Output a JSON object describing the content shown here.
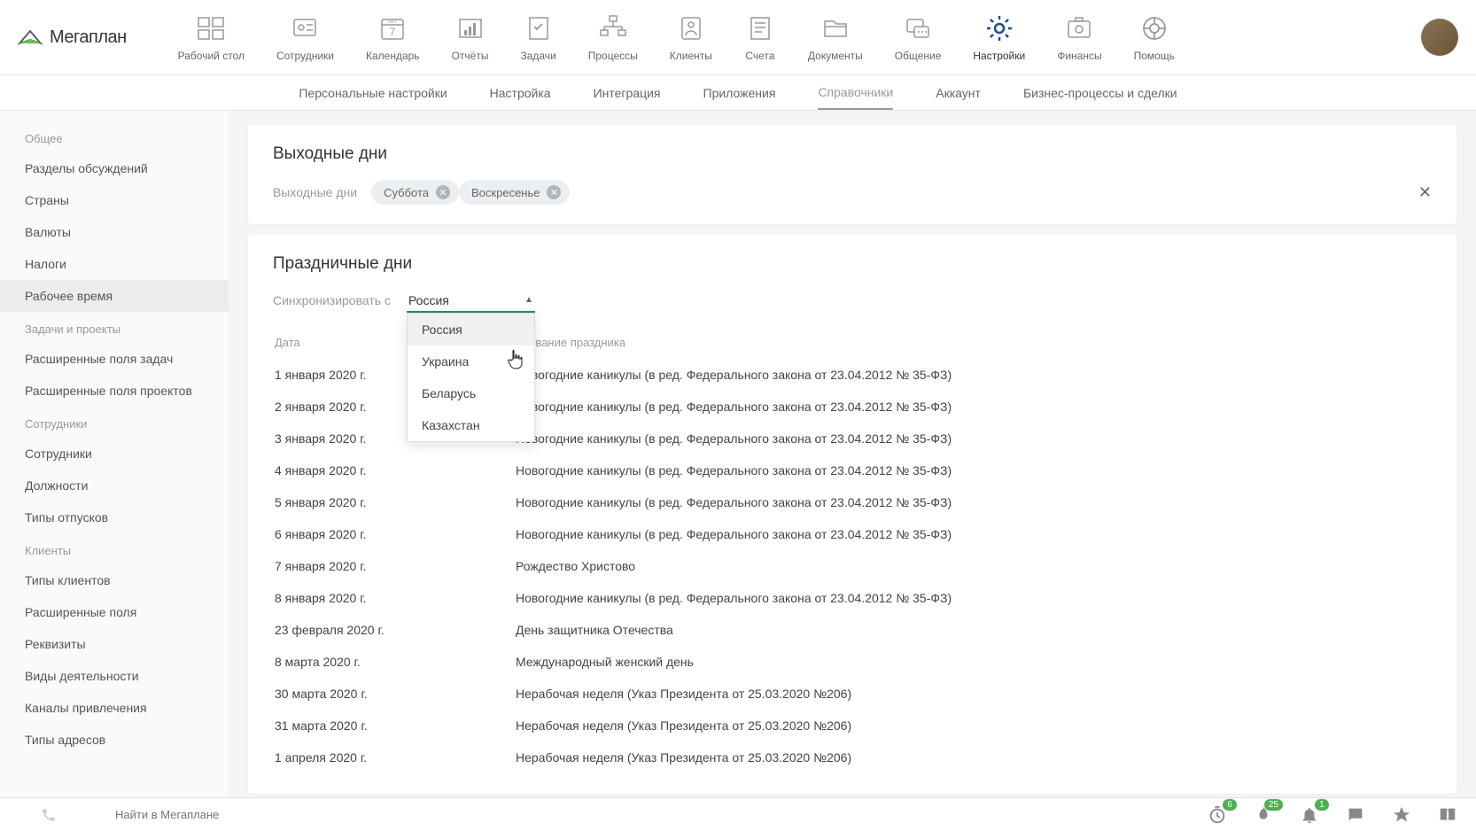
{
  "logo_text": "Мегаплан",
  "main_nav": [
    {
      "label": "Рабочий стол"
    },
    {
      "label": "Сотрудники"
    },
    {
      "label": "Календарь",
      "day": "7",
      "month": "ОКТ"
    },
    {
      "label": "Отчёты"
    },
    {
      "label": "Задачи"
    },
    {
      "label": "Процессы"
    },
    {
      "label": "Клиенты"
    },
    {
      "label": "Счета"
    },
    {
      "label": "Документы"
    },
    {
      "label": "Общение"
    },
    {
      "label": "Настройки"
    },
    {
      "label": "Финансы"
    },
    {
      "label": "Помощь"
    }
  ],
  "subnav": [
    {
      "label": "Персональные настройки"
    },
    {
      "label": "Настройка"
    },
    {
      "label": "Интеграция"
    },
    {
      "label": "Приложения"
    },
    {
      "label": "Справочники"
    },
    {
      "label": "Аккаунт"
    },
    {
      "label": "Бизнес-процессы и сделки"
    }
  ],
  "sidebar": [
    {
      "header": "Общее",
      "items": [
        "Разделы обсуждений",
        "Страны",
        "Валюты",
        "Налоги",
        "Рабочее время"
      ]
    },
    {
      "header": "Задачи и проекты",
      "items": [
        "Расширенные поля задач",
        "Расширенные поля проектов"
      ]
    },
    {
      "header": "Сотрудники",
      "items": [
        "Сотрудники",
        "Должности",
        "Типы отпусков"
      ]
    },
    {
      "header": "Клиенты",
      "items": [
        "Типы клиентов",
        "Расширенные поля",
        "Реквизиты",
        "Виды деятельности",
        "Каналы привлечения",
        "Типы адресов"
      ]
    }
  ],
  "weekends": {
    "title": "Выходные дни",
    "label": "Выходные дни",
    "chips": [
      "Суббота",
      "Воскресенье"
    ]
  },
  "holidays": {
    "title": "Праздничные дни",
    "sync_label": "Синхронизировать с",
    "sync_value": "Россия",
    "dropdown": [
      "Россия",
      "Украина",
      "Беларусь",
      "Казахстан"
    ],
    "columns": {
      "date": "Дата",
      "name": "Название праздника"
    },
    "rows": [
      {
        "date": "1 января 2020 г.",
        "name": "Новогодние каникулы (в ред. Федерального закона от 23.04.2012 № 35-ФЗ)"
      },
      {
        "date": "2 января 2020 г.",
        "name": "Новогодние каникулы (в ред. Федерального закона от 23.04.2012 № 35-ФЗ)"
      },
      {
        "date": "3 января 2020 г.",
        "name": "Новогодние каникулы (в ред. Федерального закона от 23.04.2012 № 35-ФЗ)"
      },
      {
        "date": "4 января 2020 г.",
        "name": "Новогодние каникулы (в ред. Федерального закона от 23.04.2012 № 35-ФЗ)"
      },
      {
        "date": "5 января 2020 г.",
        "name": "Новогодние каникулы (в ред. Федерального закона от 23.04.2012 № 35-ФЗ)"
      },
      {
        "date": "6 января 2020 г.",
        "name": "Новогодние каникулы (в ред. Федерального закона от 23.04.2012 № 35-ФЗ)"
      },
      {
        "date": "7 января 2020 г.",
        "name": "Рождество Христово"
      },
      {
        "date": "8 января 2020 г.",
        "name": "Новогодние каникулы (в ред. Федерального закона от 23.04.2012 № 35-ФЗ)"
      },
      {
        "date": "23 февраля 2020 г.",
        "name": "День защитника Отечества"
      },
      {
        "date": "8 марта 2020 г.",
        "name": "Международный женский день"
      },
      {
        "date": "30 марта 2020 г.",
        "name": "Нерабочая неделя (Указ Президента от 25.03.2020 №206)"
      },
      {
        "date": "31 марта 2020 г.",
        "name": "Нерабочая неделя (Указ Президента от 25.03.2020 №206)"
      },
      {
        "date": "1 апреля 2020 г.",
        "name": "Нерабочая неделя (Указ Президента от 25.03.2020 №206)"
      }
    ]
  },
  "bottombar": {
    "search_placeholder": "Найти в Мегаплане",
    "badges": {
      "clock": "6",
      "fire": "25",
      "bell": "1"
    }
  }
}
